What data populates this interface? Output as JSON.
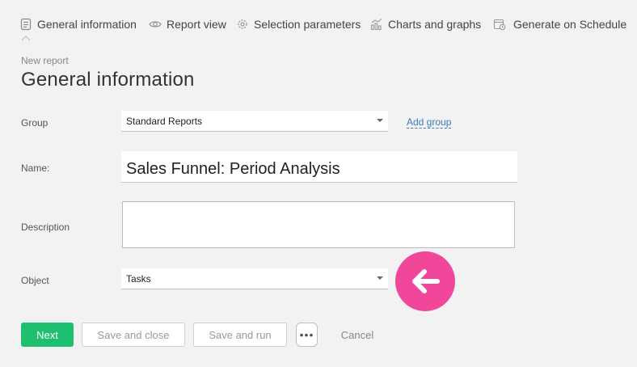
{
  "tabs": [
    {
      "label": "General information",
      "icon": "document-icon"
    },
    {
      "label": "Report view",
      "icon": "eye-icon"
    },
    {
      "label": "Selection parameters",
      "icon": "gear-icon"
    },
    {
      "label": "Charts and graphs",
      "icon": "chart-icon"
    },
    {
      "label": "Generate on Schedule",
      "icon": "calendar-clock-icon"
    }
  ],
  "header": {
    "breadcrumb": "New report",
    "title": "General information"
  },
  "form": {
    "group": {
      "label": "Group",
      "value": "Standard Reports",
      "add_link": "Add group"
    },
    "name": {
      "label": "Name:",
      "value": "Sales Funnel: Period Analysis"
    },
    "description": {
      "label": "Description",
      "value": ""
    },
    "object": {
      "label": "Object",
      "value": "Tasks"
    }
  },
  "actions": {
    "next": "Next",
    "save_close": "Save and close",
    "save_run": "Save and run",
    "more": "•••",
    "cancel": "Cancel"
  },
  "colors": {
    "primary_button": "#1ebf6e",
    "marker": "#f0479a",
    "link": "#3a7bbf",
    "background": "#f2f2f2"
  }
}
